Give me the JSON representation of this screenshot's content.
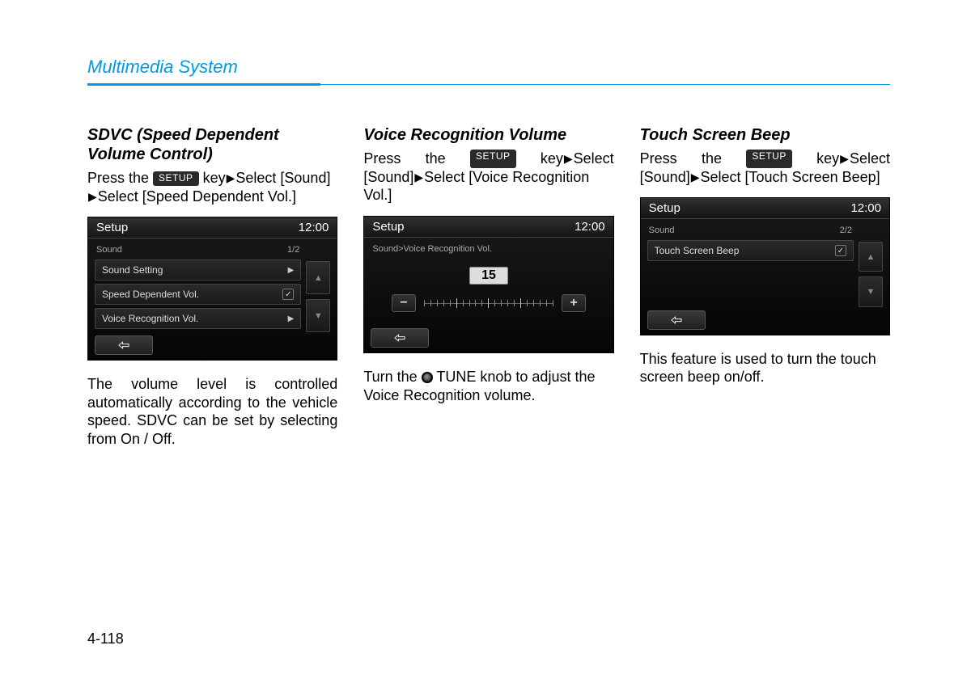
{
  "header": {
    "title": "Multimedia System"
  },
  "badge": "SETUP",
  "triangle": "▶",
  "col1": {
    "heading": "SDVC (Speed Dependent Volume Control)",
    "instr_parts": {
      "p1": "Press the ",
      "p2": " key",
      "p3": "Select [Sound] ",
      "p4": "Select [Speed Dependent Vol.]"
    },
    "device": {
      "title": "Setup",
      "clock": "12:00",
      "breadcrumb": "Sound",
      "page": "1/2",
      "rows": [
        {
          "label": "Sound Setting",
          "icon": "chev"
        },
        {
          "label": "Speed Dependent Vol.",
          "icon": "check"
        },
        {
          "label": "Voice Recognition Vol.",
          "icon": "chev"
        }
      ]
    },
    "desc": "The volume level is controlled automatically according to the vehicle speed. SDVC can be set by selecting from On / Off."
  },
  "col2": {
    "heading": "Voice Recognition Volume",
    "instr_parts": {
      "p1a": "Press",
      "p1b": "the",
      "p1c": "key",
      "p1d": "Select",
      "p2": "[Sound]",
      "p3": "Select [Voice Recognition Vol.]"
    },
    "device": {
      "title": "Setup",
      "clock": "12:00",
      "breadcrumb": "Sound>Voice Recognition Vol.",
      "value": "15"
    },
    "desc_pre": "Turn the ",
    "desc_post": " TUNE knob to adjust the Voice Recognition volume."
  },
  "col3": {
    "heading": "Touch Screen Beep",
    "instr_parts": {
      "p1a": "Press",
      "p1b": "the",
      "p1c": "key",
      "p1d": "Select",
      "p2": "[Sound]",
      "p3": "Select [Touch Screen Beep]"
    },
    "device": {
      "title": "Setup",
      "clock": "12:00",
      "breadcrumb": "Sound",
      "page": "2/2",
      "row": {
        "label": "Touch Screen Beep"
      }
    },
    "desc": "This feature is used to turn the touch screen beep on/off."
  },
  "page_number": "4-118"
}
